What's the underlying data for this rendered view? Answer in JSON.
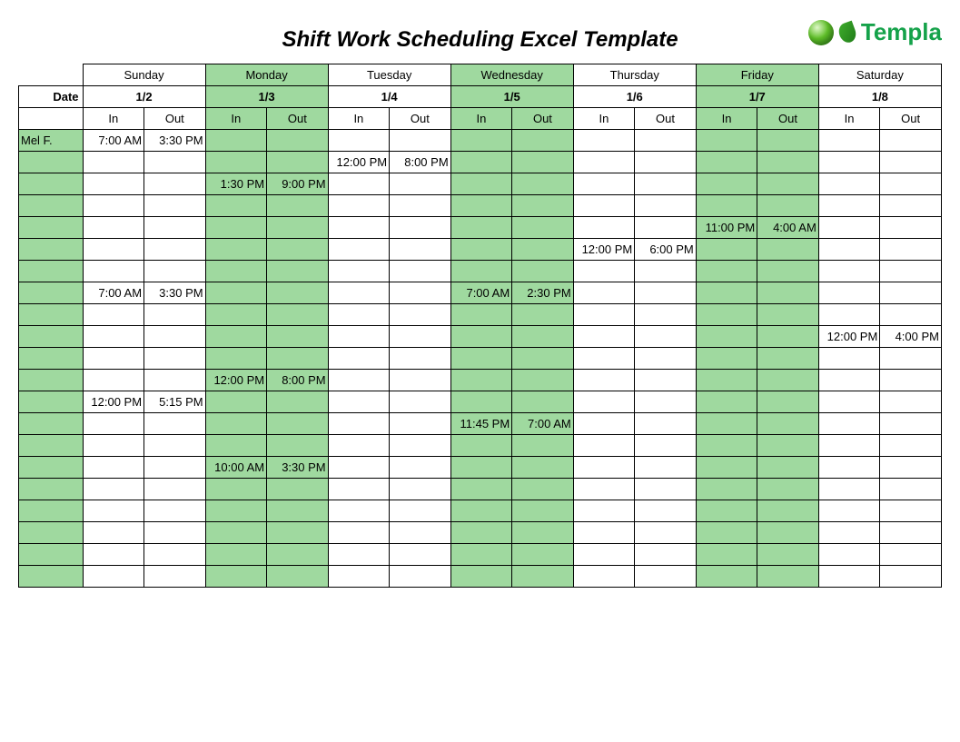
{
  "title": "Shift Work Scheduling Excel Template",
  "logo_text": "Templa",
  "date_label": "Date",
  "in_label": "In",
  "out_label": "Out",
  "days": [
    {
      "name": "Sunday",
      "date": "1/2",
      "green": false
    },
    {
      "name": "Monday",
      "date": "1/3",
      "green": true
    },
    {
      "name": "Tuesday",
      "date": "1/4",
      "green": false
    },
    {
      "name": "Wednesday",
      "date": "1/5",
      "green": true
    },
    {
      "name": "Thursday",
      "date": "1/6",
      "green": false
    },
    {
      "name": "Friday",
      "date": "1/7",
      "green": true
    },
    {
      "name": "Saturday",
      "date": "1/8",
      "green": false
    }
  ],
  "rows": [
    {
      "name": "Mel F.",
      "cells": [
        "7:00 AM",
        "3:30 PM",
        "",
        "",
        "",
        "",
        "",
        "",
        "",
        "",
        "",
        "",
        "",
        ""
      ]
    },
    {
      "name": "",
      "cells": [
        "",
        "",
        "",
        "",
        "12:00 PM",
        "8:00 PM",
        "",
        "",
        "",
        "",
        "",
        "",
        "",
        ""
      ]
    },
    {
      "name": "",
      "cells": [
        "",
        "",
        "1:30 PM",
        "9:00 PM",
        "",
        "",
        "",
        "",
        "",
        "",
        "",
        "",
        "",
        ""
      ]
    },
    {
      "name": "",
      "cells": [
        "",
        "",
        "",
        "",
        "",
        "",
        "",
        "",
        "",
        "",
        "",
        "",
        "",
        ""
      ]
    },
    {
      "name": "",
      "cells": [
        "",
        "",
        "",
        "",
        "",
        "",
        "",
        "",
        "",
        "",
        "11:00 PM",
        "4:00 AM",
        "",
        ""
      ]
    },
    {
      "name": "",
      "cells": [
        "",
        "",
        "",
        "",
        "",
        "",
        "",
        "",
        "12:00 PM",
        "6:00 PM",
        "",
        "",
        "",
        ""
      ]
    },
    {
      "name": "",
      "cells": [
        "",
        "",
        "",
        "",
        "",
        "",
        "",
        "",
        "",
        "",
        "",
        "",
        "",
        ""
      ]
    },
    {
      "name": "",
      "cells": [
        "7:00 AM",
        "3:30 PM",
        "",
        "",
        "",
        "",
        "7:00 AM",
        "2:30 PM",
        "",
        "",
        "",
        "",
        "",
        ""
      ]
    },
    {
      "name": "",
      "cells": [
        "",
        "",
        "",
        "",
        "",
        "",
        "",
        "",
        "",
        "",
        "",
        "",
        "",
        ""
      ]
    },
    {
      "name": "",
      "cells": [
        "",
        "",
        "",
        "",
        "",
        "",
        "",
        "",
        "",
        "",
        "",
        "",
        "12:00 PM",
        "4:00 PM"
      ]
    },
    {
      "name": "",
      "cells": [
        "",
        "",
        "",
        "",
        "",
        "",
        "",
        "",
        "",
        "",
        "",
        "",
        "",
        ""
      ]
    },
    {
      "name": "",
      "cells": [
        "",
        "",
        "12:00 PM",
        "8:00 PM",
        "",
        "",
        "",
        "",
        "",
        "",
        "",
        "",
        "",
        ""
      ]
    },
    {
      "name": "",
      "cells": [
        "12:00 PM",
        "5:15 PM",
        "",
        "",
        "",
        "",
        "",
        "",
        "",
        "",
        "",
        "",
        "",
        ""
      ]
    },
    {
      "name": "",
      "cells": [
        "",
        "",
        "",
        "",
        "",
        "",
        "11:45 PM",
        "7:00 AM",
        "",
        "",
        "",
        "",
        "",
        ""
      ]
    },
    {
      "name": "",
      "cells": [
        "",
        "",
        "",
        "",
        "",
        "",
        "",
        "",
        "",
        "",
        "",
        "",
        "",
        ""
      ]
    },
    {
      "name": "",
      "cells": [
        "",
        "",
        "10:00 AM",
        "3:30 PM",
        "",
        "",
        "",
        "",
        "",
        "",
        "",
        "",
        "",
        ""
      ]
    },
    {
      "name": "",
      "cells": [
        "",
        "",
        "",
        "",
        "",
        "",
        "",
        "",
        "",
        "",
        "",
        "",
        "",
        ""
      ]
    },
    {
      "name": "",
      "cells": [
        "",
        "",
        "",
        "",
        "",
        "",
        "",
        "",
        "",
        "",
        "",
        "",
        "",
        ""
      ]
    },
    {
      "name": "",
      "cells": [
        "",
        "",
        "",
        "",
        "",
        "",
        "",
        "",
        "",
        "",
        "",
        "",
        "",
        ""
      ]
    },
    {
      "name": "",
      "cells": [
        "",
        "",
        "",
        "",
        "",
        "",
        "",
        "",
        "",
        "",
        "",
        "",
        "",
        ""
      ]
    },
    {
      "name": "",
      "cells": [
        "",
        "",
        "",
        "",
        "",
        "",
        "",
        "",
        "",
        "",
        "",
        "",
        "",
        ""
      ]
    }
  ]
}
